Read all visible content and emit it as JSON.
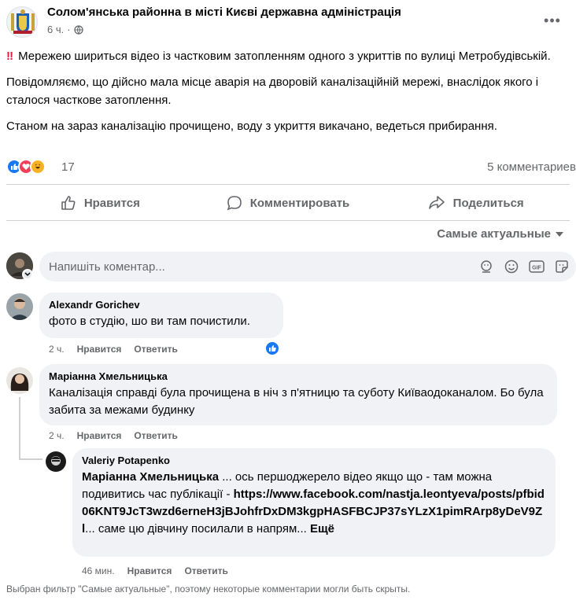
{
  "post": {
    "page_name": "Солом'янська районна в місті Києві державна адміністрація",
    "time": "6 ч.",
    "privacy_icon": "globe-icon",
    "alert_icon": "double-exclamation-icon",
    "paragraphs": [
      "Мережею шириться відео із частковим затопленням одного з укриттів по вулиці Метробудівській.",
      "Повідомляємо, що дійсно мала місце аварія на дворовій каналізаційній мережі, внаслідок якого і сталося часткове затоплення.",
      "Станом на зараз каналізацію прочищено, воду з укриття викачано, ведеться прибирання."
    ],
    "reaction_count": "17",
    "comment_count": "5 комментариев",
    "reaction_icons": [
      "like-icon",
      "love-icon",
      "haha-icon"
    ]
  },
  "actions": {
    "like": "Нравится",
    "comment": "Комментировать",
    "share": "Поделиться"
  },
  "sort_label": "Самые актуальные",
  "composer": {
    "placeholder": "Напишіть коментар...",
    "icons": [
      "avatar-sticker-icon",
      "emoji-icon",
      "gif-icon",
      "sticker-icon"
    ]
  },
  "comments": [
    {
      "author": "Alexandr Gorichev",
      "text": "фото в студію, шо ви там почистили.",
      "time": "2 ч.",
      "like": "Нравится",
      "reply": "Ответить",
      "reaction": "like-icon"
    },
    {
      "author": "Маріанна Хмельницька",
      "text": "Каналізація справді була прочищена в ніч з п'ятницю та суботу Київаодоканалом. Бо була забита за межами будинку",
      "time": "2 ч.",
      "like": "Нравится",
      "reply": "Ответить"
    }
  ],
  "reply": {
    "author": "Valeriy Potapenko",
    "mention": "Маріанна Хмельницька",
    "text_before_link": " ... ось першоджерело відео якщо що - там можна подивитись час публікації -",
    "link": "https://www.facebook.com/nastja.leontyeva/posts/pfbid06KNT9JcT3wzd6erneH3jBJohfrDxDM3kgpHASFBCJP37sYLzX1pimRArp8yDeV9Zl",
    "text_after_link": "... саме цю дівчину посилали в напрям...",
    "more": "Ещё",
    "time": "46 мин.",
    "like": "Нравится",
    "reply": "Ответить"
  },
  "footer_note": "Выбран фильтр \"Самые актуальные\", поэтому некоторые комментарии могли быть скрыты."
}
